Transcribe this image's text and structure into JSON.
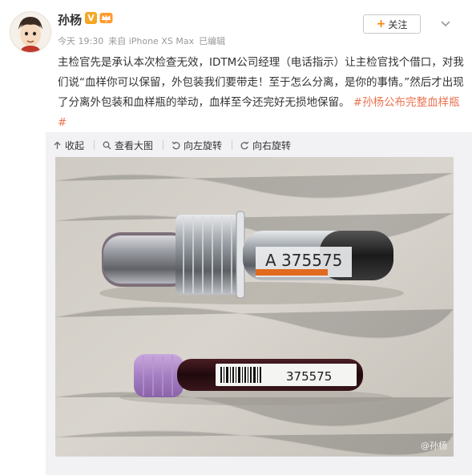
{
  "header": {
    "username": "孙杨",
    "verified_mark": "V",
    "follow_label": "关注",
    "follow_plus": "+"
  },
  "meta": {
    "time": "今天 19:30",
    "source": "来自 iPhone XS Max",
    "edited": "已编辑"
  },
  "post": {
    "text": "主检官先是承认本次检查无效，IDTM公司经理（电话指示）让主检官找个借口，对我们说“血样你可以保留，外包装我们要带走！至于怎么分离，是你的事情。”然后才出现了分离外包装和血样瓶的举动，血样至今还完好无损地保留。",
    "hashtag": "#孙杨公布完整血样瓶#"
  },
  "toolbar": {
    "collapse": "收起",
    "view_large": "查看大图",
    "rotate_left": "向左旋转",
    "rotate_right": "向右旋转"
  },
  "photo": {
    "container_label": "A 375575",
    "tube_label": "375575",
    "watermark": "@孙杨"
  },
  "colors": {
    "accent": "#ff8200",
    "hashtag": "#eb7350",
    "verified": "#f5a623"
  }
}
